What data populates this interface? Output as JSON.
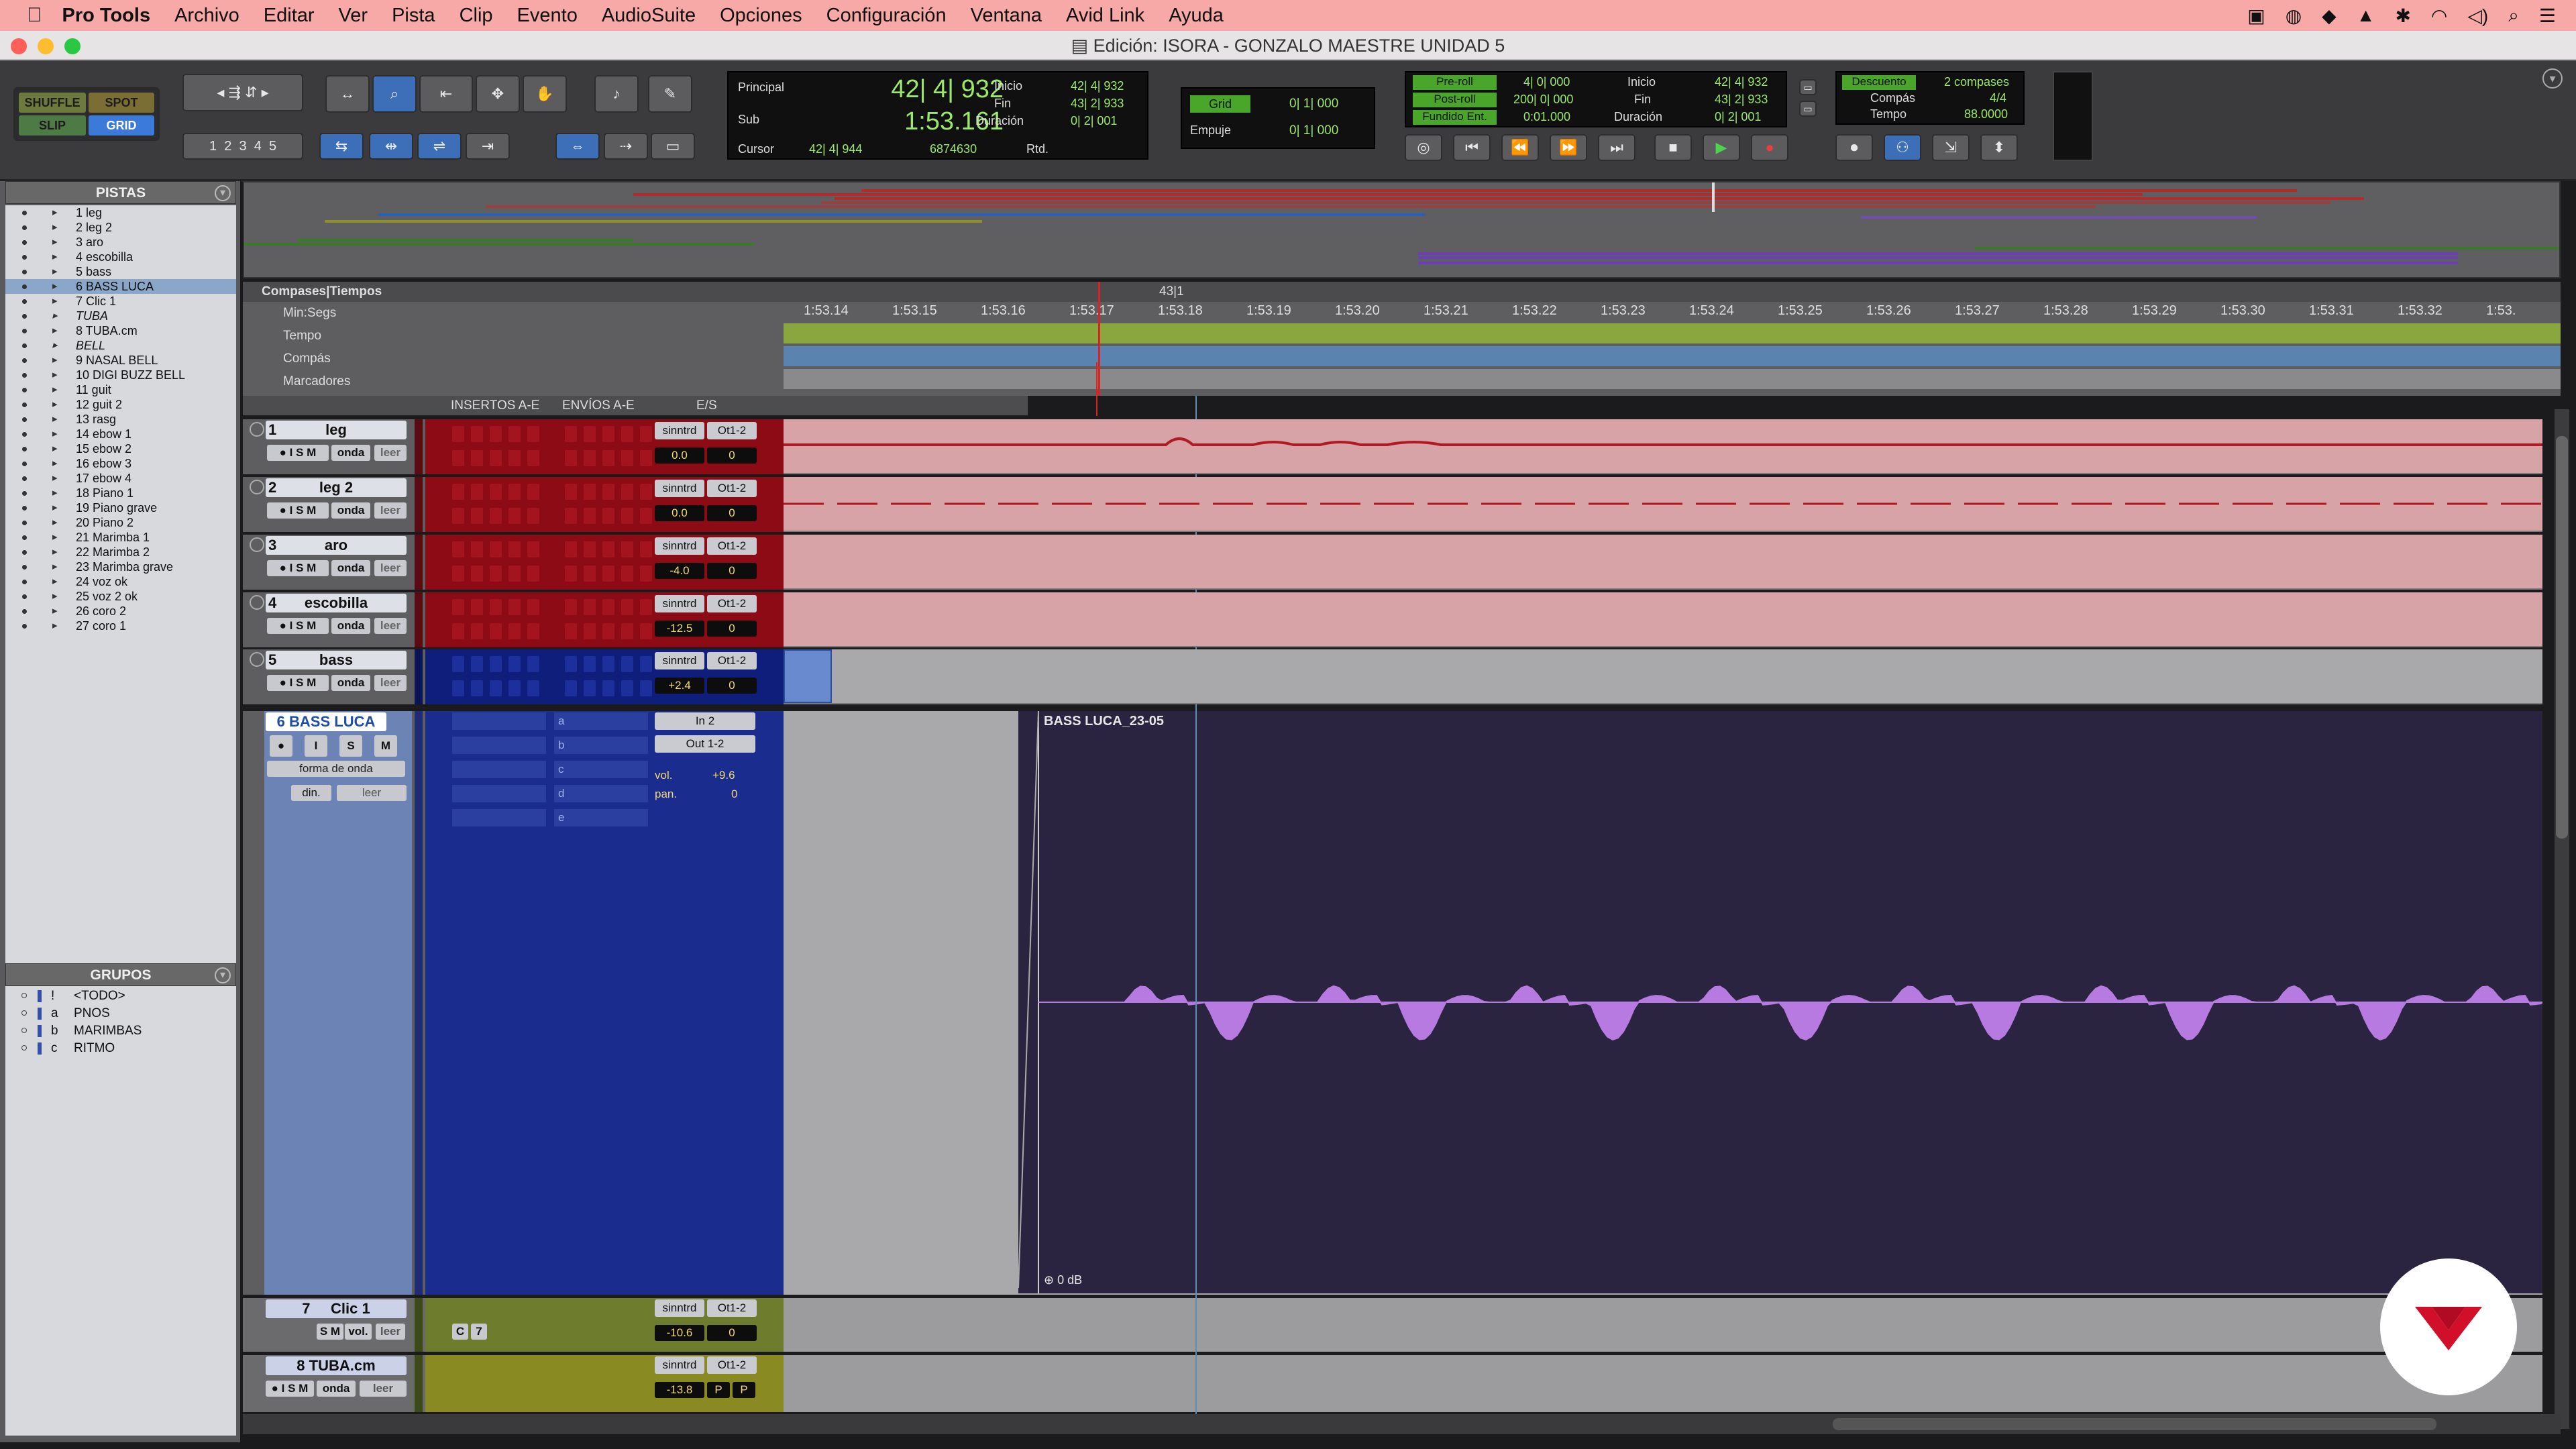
{
  "menubar": {
    "app": "Pro Tools",
    "items": [
      "Archivo",
      "Editar",
      "Ver",
      "Pista",
      "Clip",
      "Evento",
      "AudioSuite",
      "Opciones",
      "Configuración",
      "Ventana",
      "Avid Link",
      "Ayuda"
    ]
  },
  "window": {
    "title": "Edición: ISORA - GONZALO MAESTRE UNIDAD 5"
  },
  "toolbar": {
    "modes": {
      "shuffle": "SHUFFLE",
      "spot": "SPOT",
      "slip": "SLIP",
      "grid": "GRID"
    },
    "zoom_presets": [
      "1",
      "2",
      "3",
      "4",
      "5"
    ],
    "counter": {
      "principal_label": "Principal",
      "principal": "42| 4| 932",
      "sub_label": "Sub",
      "sub": "1:53.161",
      "cursor_label": "Cursor",
      "cursor": "42| 4| 944",
      "sample": "6874630",
      "inicio_label": "Inicio",
      "inicio": "42| 4| 932",
      "fin_label": "Fin",
      "fin": "43| 2| 933",
      "duracion_label": "Duración",
      "duracion": "0| 2| 001",
      "rtd": "Rtd."
    },
    "grid": {
      "grid_label": "Grid",
      "grid_val": "0| 1| 000",
      "empuje_label": "Empuje",
      "empuje_val": "0| 1| 000"
    },
    "transport": {
      "preroll_label": "Pre-roll",
      "preroll": "4| 0| 000",
      "postroll_label": "Post-roll",
      "postroll": "200| 0| 000",
      "fundido_label": "Fundido Ent.",
      "fundido": "0:01.000",
      "inicio_label": "Inicio",
      "inicio": "42| 4| 932",
      "fin_label": "Fin",
      "fin": "43| 2| 933",
      "duracion_label": "Duración",
      "duracion": "0| 2| 001"
    },
    "countoff": {
      "descuento_label": "Descuento",
      "descuento": "2 compases",
      "compas_label": "Compás",
      "compas": "4/4",
      "tempo_label": "Tempo",
      "tempo": "88.0000"
    }
  },
  "tracks_panel": {
    "title": "PISTAS",
    "tracks": [
      "1 leg",
      "2 leg 2",
      "3 aro",
      "4 escobilla",
      "5 bass",
      "6 BASS LUCA",
      "7 Clic 1",
      "TUBA",
      "8 TUBA.cm",
      "BELL",
      "9 NASAL BELL",
      "10 DIGI BUZZ BELL",
      "11 guit",
      "12 guit 2",
      "13 rasg",
      "14 ebow 1",
      "15 ebow 2",
      "16 ebow 3",
      "17 ebow 4",
      "18 Piano 1",
      "19 Piano grave",
      "20 Piano 2",
      "21 Marimba 1",
      "22 Marimba 2",
      "23 Marimba grave",
      "24 voz ok",
      "25 voz 2 ok",
      "26 coro 2",
      "27 coro 1"
    ]
  },
  "groups_panel": {
    "title": "GRUPOS",
    "groups": [
      {
        "id": "!",
        "name": "<TODO>"
      },
      {
        "id": "a",
        "name": "PNOS"
      },
      {
        "id": "b",
        "name": "MARIMBAS"
      },
      {
        "id": "c",
        "name": "RITMO"
      }
    ]
  },
  "rulers": {
    "compases": "Compases|Tiempos",
    "minsegs": "Min:Segs",
    "tempo": "Tempo",
    "compas": "Compás",
    "marcadores": "Marcadores",
    "bar_marker": "43|1",
    "ticks": [
      "1:53.14",
      "1:53.15",
      "1:53.16",
      "1:53.17",
      "1:53.18",
      "1:53.19",
      "1:53.20",
      "1:53.21",
      "1:53.22",
      "1:53.23",
      "1:53.24",
      "1:53.25",
      "1:53.26",
      "1:53.27",
      "1:53.28",
      "1:53.29",
      "1:53.30",
      "1:53.31",
      "1:53.32",
      "1:53."
    ]
  },
  "mixer_header": {
    "insertos": "INSERTOS A-E",
    "envios": "ENVÍOS A-E",
    "es": "E/S"
  },
  "track_rows": [
    {
      "num": "1",
      "name": "leg",
      "view": "onda",
      "auto": "leer",
      "input": "sinntrd",
      "output": "Ot1-2",
      "vol": "0.0",
      "pan": "0"
    },
    {
      "num": "2",
      "name": "leg 2",
      "view": "onda",
      "auto": "leer",
      "input": "sinntrd",
      "output": "Ot1-2",
      "vol": "0.0",
      "pan": "0"
    },
    {
      "num": "3",
      "name": "aro",
      "view": "onda",
      "auto": "leer",
      "input": "sinntrd",
      "output": "Ot1-2",
      "vol": "-4.0",
      "pan": "0"
    },
    {
      "num": "4",
      "name": "escobilla",
      "view": "onda",
      "auto": "leer",
      "input": "sinntrd",
      "output": "Ot1-2",
      "vol": "-12.5",
      "pan": "0"
    },
    {
      "num": "5",
      "name": "bass",
      "view": "onda",
      "auto": "leer",
      "input": "sinntrd",
      "output": "Ot1-2",
      "vol": "+2.4",
      "pan": "0"
    }
  ],
  "bass_luca": {
    "num": "6",
    "name": "BASS LUCA",
    "rec": "●",
    "i": "I",
    "s": "S",
    "m": "M",
    "view": "forma de onda",
    "din": "din.",
    "auto": "leer",
    "input": "In 2",
    "output": "Out 1-2",
    "vol_label": "vol.",
    "vol": "+9.6",
    "pan_label": "pan.",
    "pan": "0",
    "sends": [
      "a",
      "b",
      "c",
      "d",
      "e"
    ],
    "clip_name": "BASS LUCA_23-05",
    "db": "0 dB"
  },
  "clic": {
    "num": "7",
    "name": "Clic 1",
    "view": "vol.",
    "auto": "leer",
    "input": "sinntrd",
    "output": "Ot1-2",
    "vol": "-10.6",
    "pan": "0",
    "ins": "C",
    "ins2": "7"
  },
  "tuba": {
    "num": "8",
    "name": "TUBA.cm",
    "view": "onda",
    "auto": "leer",
    "input": "sinntrd",
    "output": "Ot1-2",
    "vol": "-13.8",
    "pan": "P",
    "pan2": "P"
  },
  "colors": {
    "red_track": "#d8a3a6",
    "blue_track": "#1f3a8c",
    "bass_region": "#2b2440",
    "waveform": "#b67ae0",
    "accent_red": "#d10f2a"
  }
}
